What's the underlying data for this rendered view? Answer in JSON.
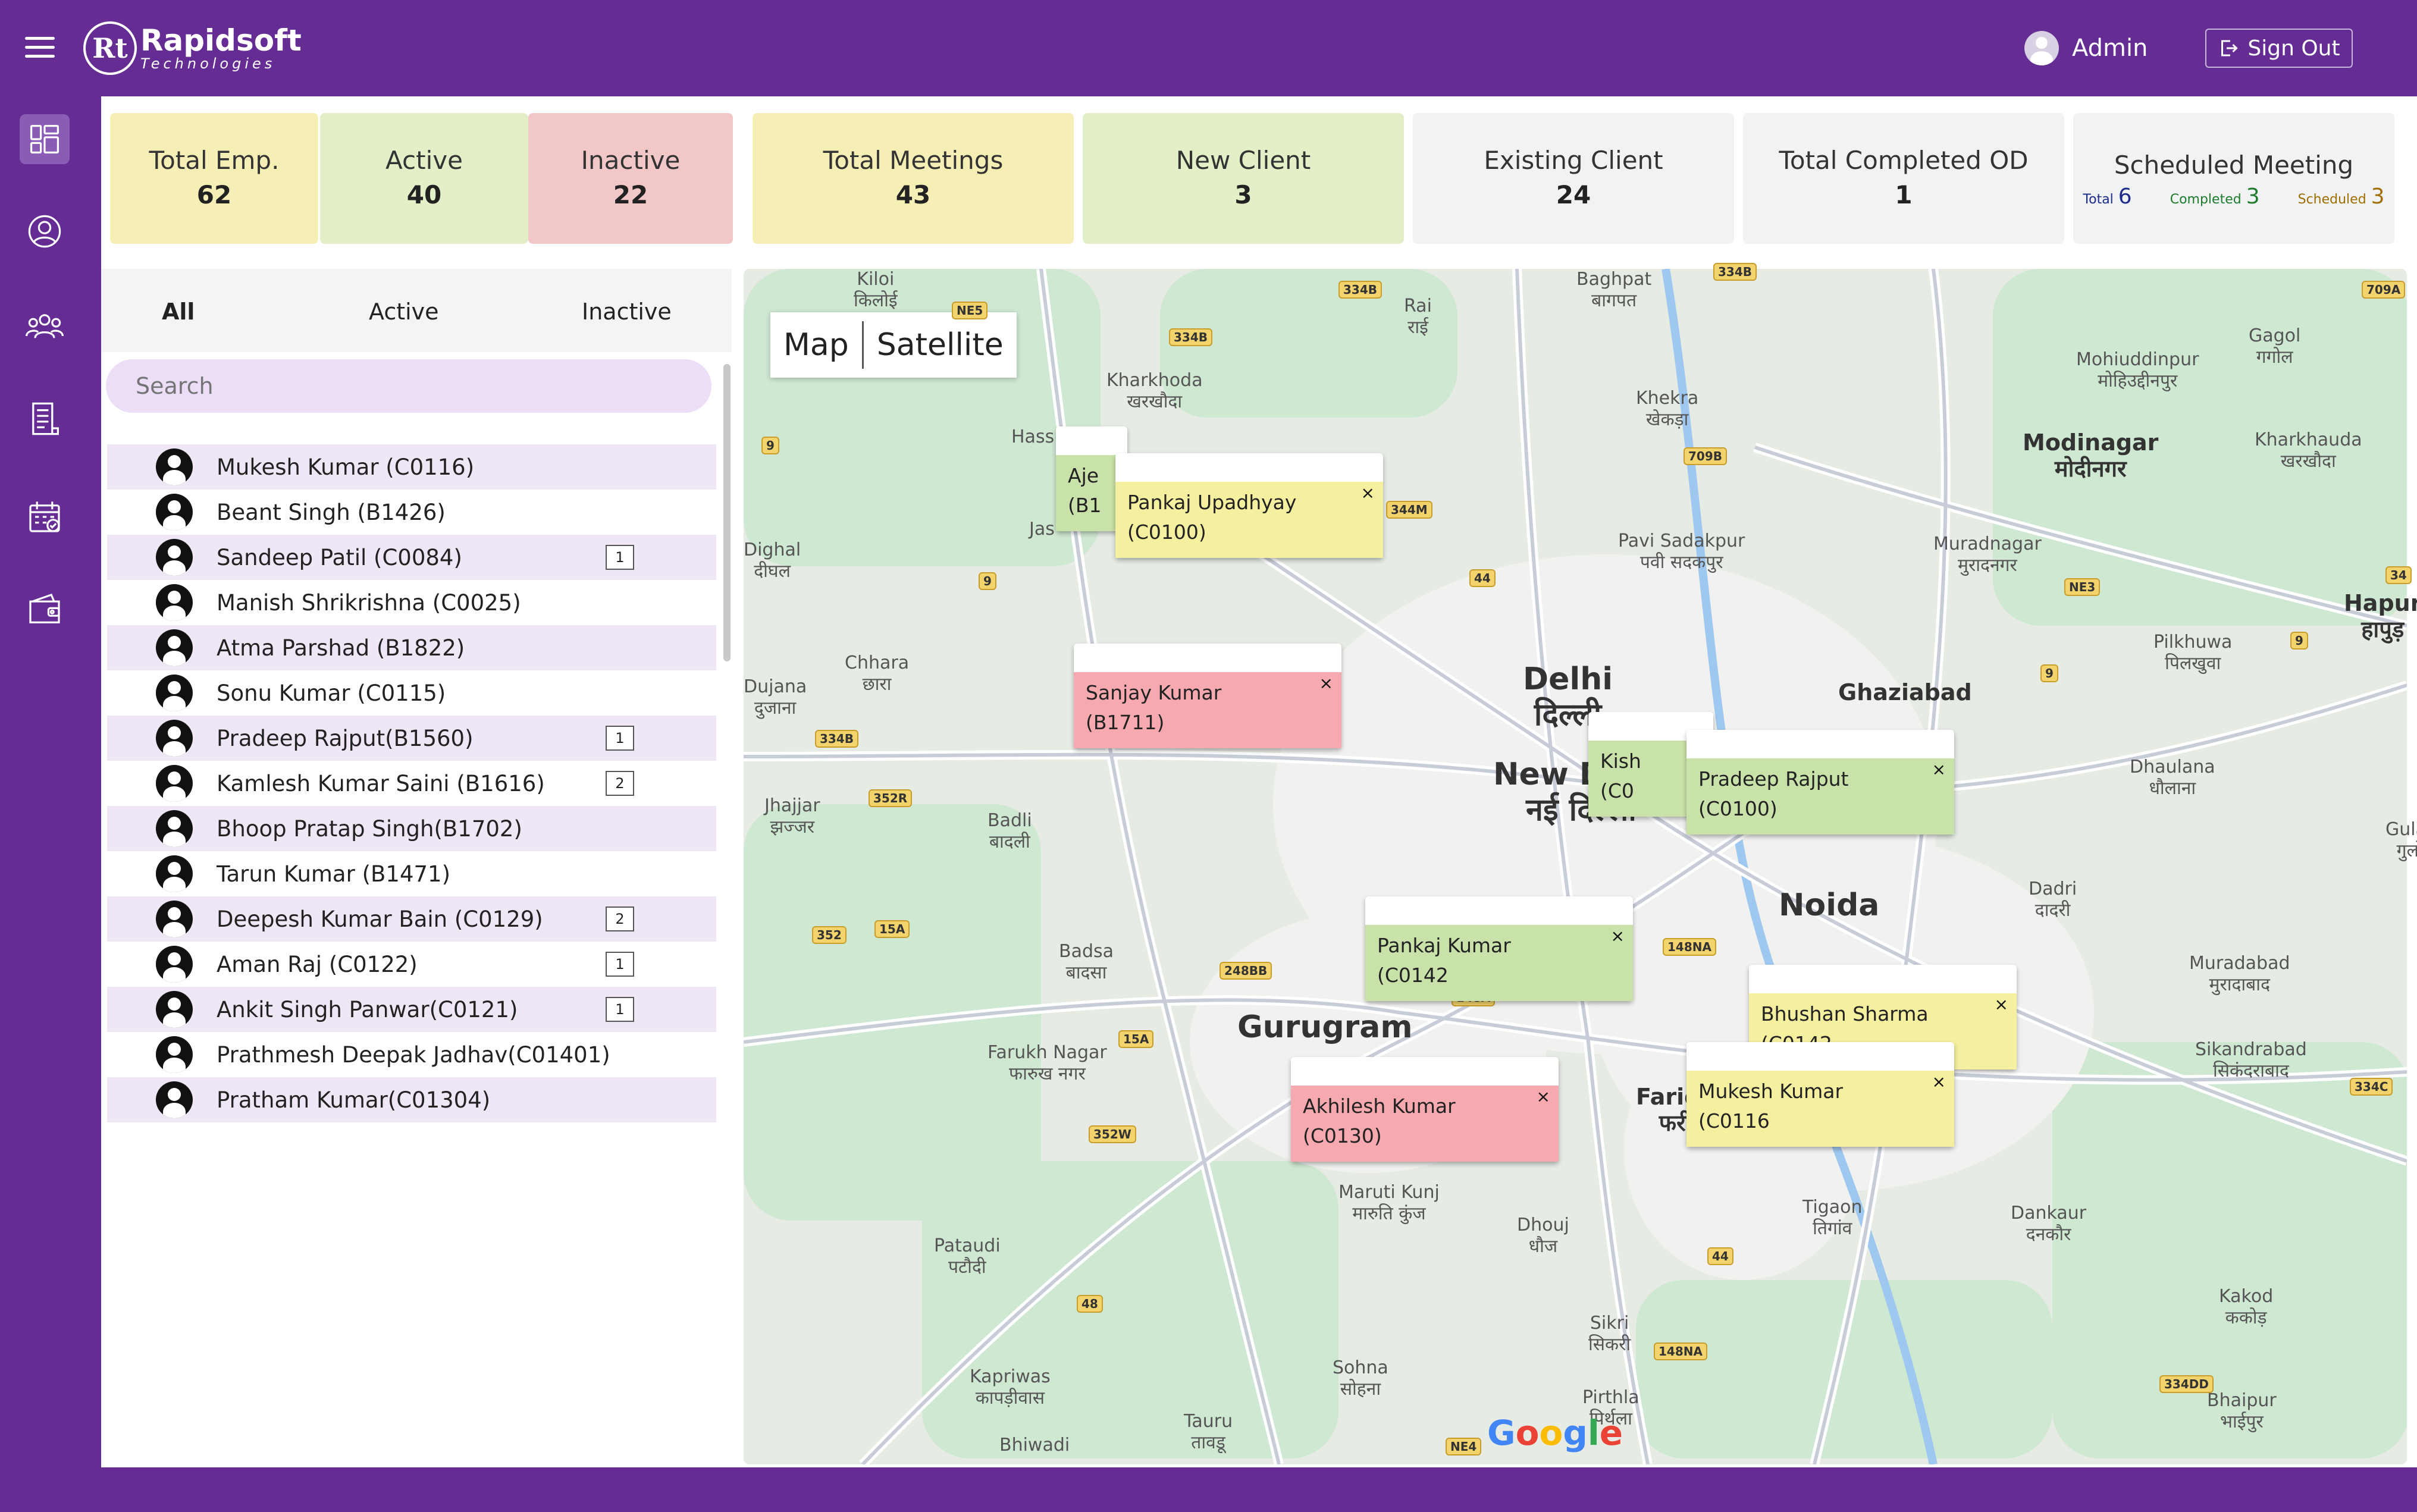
{
  "header": {
    "logo_mark": "Rt",
    "logo_name": "Rapidsoft",
    "logo_sub": "Technologies",
    "user_name": "Admin",
    "sign_out_label": "Sign Out"
  },
  "sidebar": {
    "items": [
      {
        "icon": "dashboard-icon",
        "active": true
      },
      {
        "icon": "profile-icon",
        "active": false
      },
      {
        "icon": "team-icon",
        "active": false
      },
      {
        "icon": "report-icon",
        "active": false
      },
      {
        "icon": "calendar-icon",
        "active": false
      },
      {
        "icon": "wallet-icon",
        "active": false
      }
    ]
  },
  "stats": {
    "total_emp": {
      "label": "Total Emp.",
      "value": "62"
    },
    "active": {
      "label": "Active",
      "value": "40"
    },
    "inactive": {
      "label": "Inactive",
      "value": "22"
    },
    "total_meetings": {
      "label": "Total Meetings",
      "value": "43"
    },
    "new_client": {
      "label": "New Client",
      "value": "3"
    },
    "existing_client": {
      "label": "Existing Client",
      "value": "24"
    },
    "total_completed_od": {
      "label": "Total Completed OD",
      "value": "1"
    },
    "scheduled_meeting": {
      "label": "Scheduled Meeting",
      "total_label": "Total",
      "total_value": "6",
      "completed_label": "Completed",
      "completed_value": "3",
      "scheduled_label": "Scheduled",
      "scheduled_value": "3"
    }
  },
  "filters": {
    "all": "All",
    "active": "Active",
    "inactive": "Inactive"
  },
  "search": {
    "placeholder": "Search"
  },
  "employees": [
    {
      "name": "Mukesh Kumar (C0116)",
      "count": ""
    },
    {
      "name": "Beant Singh (B1426)",
      "count": ""
    },
    {
      "name": "Sandeep Patil (C0084)",
      "count": "1"
    },
    {
      "name": "Manish Shrikrishna (C0025)",
      "count": ""
    },
    {
      "name": "Atma Parshad (B1822)",
      "count": ""
    },
    {
      "name": "Sonu Kumar (C0115)",
      "count": ""
    },
    {
      "name": "Pradeep Rajput(B1560)",
      "count": "1"
    },
    {
      "name": "Kamlesh Kumar Saini (B1616)",
      "count": "2"
    },
    {
      "name": "Bhoop Pratap Singh(B1702)",
      "count": ""
    },
    {
      "name": "Tarun Kumar (B1471)",
      "count": ""
    },
    {
      "name": "Deepesh Kumar Bain (C0129)",
      "count": "2"
    },
    {
      "name": "Aman Raj (C0122)",
      "count": "1"
    },
    {
      "name": "Ankit Singh Panwar(C0121)",
      "count": "1"
    },
    {
      "name": "Prathmesh Deepak Jadhav(C01401)",
      "count": ""
    },
    {
      "name": "Pratham Kumar(C01304)",
      "count": ""
    }
  ],
  "map": {
    "type_map": "Map",
    "type_satellite": "Satellite",
    "google": "Google",
    "popups": [
      {
        "line1": "Aje",
        "line2": "(B1"
      },
      {
        "line1": "Pankaj Upadhyay",
        "line2": "(C0100)"
      },
      {
        "line1": "Sanjay Kumar",
        "line2": "(B1711)"
      },
      {
        "line1": "Kish",
        "line2": "(C0"
      },
      {
        "line1": "Pradeep Rajput",
        "line2": "(C0100)"
      },
      {
        "line1": "Pankaj Kumar",
        "line2": "(C0142"
      },
      {
        "line1": "Bhushan Sharma",
        "line2": "(C0142"
      },
      {
        "line1": "Mukesh Kumar",
        "line2": "(C0116"
      },
      {
        "line1": "Akhilesh Kumar",
        "line2": "(C0130)"
      }
    ],
    "close_glyph": "×",
    "places": {
      "delhi": "Delhi",
      "delhi_hi": "दिल्ली",
      "new_delhi": "New Delhi",
      "new_delhi_hi": "नई दिल्ली",
      "noida": "Noida",
      "gurugram": "Gurugram",
      "faridabad": "Faridabad",
      "faridabad_hi": "फरीदाबाद",
      "ghaziabad": "Ghaziabad",
      "modinagar": "Modinagar",
      "modinagar_hi": "मोदीनगर",
      "hapur": "Hapur",
      "hapur_hi": "हापुड़",
      "kharkhoda": "Kharkhoda",
      "kharkhoda_hi": "खरखौदा",
      "khekra": "Khekra",
      "khekra_hi": "खेकड़ा",
      "baghpat": "Baghpat",
      "baghpat_hi": "बागपत",
      "rai": "Rai",
      "rai_hi": "राई",
      "mohiuddinpur": "Mohiuddinpur",
      "mohiuddinpur_hi": "मोहिउद्दीनपुर",
      "gagol": "Gagol",
      "gagol_hi": "गगोल",
      "kharkhauda": "Kharkhauda",
      "kharkhauda_hi": "खरखौदा",
      "pavi": "Pavi Sadakpur",
      "pavi_hi": "पवी सदकपुर",
      "muradnagar": "Muradnagar",
      "muradnagar_hi": "मुरादनगर",
      "pilkhuwa": "Pilkhuwa",
      "pilkhuwa_hi": "पिलखुवा",
      "dhaulana": "Dhaulana",
      "dhaulana_hi": "धौलाना",
      "gulaoti": "Gulaoti",
      "gulaoti_hi": "गुलोठी",
      "dadri": "Dadri",
      "dadri_hi": "दादरी",
      "muradabad": "Muradabad",
      "muradabad_hi": "मुरादाबाद",
      "sikandrabad": "Sikandrabad",
      "sikandrabad_hi": "सिकंदराबाद",
      "dankaur": "Dankaur",
      "dankaur_hi": "दनकौर",
      "tigaon": "Tigaon",
      "tigaon_hi": "तिगांव",
      "kakod": "Kakod",
      "kakod_hi": "ककोड़",
      "bhaipur": "Bhaipur",
      "bhaipur_hi": "भाईपुर",
      "chhara": "Chhara",
      "chhara_hi": "छारा",
      "badli": "Badli",
      "badli_hi": "बादली",
      "badsa": "Badsa",
      "badsa_hi": "बादसा",
      "farukh": "Farukh Nagar",
      "farukh_hi": "फारुख नगर",
      "jhajjar": "Jhajjar",
      "jhajjar_hi": "झज्जर",
      "dujana": "Dujana",
      "dujana_hi": "दुजाना",
      "dighal": "Dighal",
      "dighal_hi": "दीघल",
      "pataudi": "Pataudi",
      "pataudi_hi": "पटौदी",
      "maruti": "Maruti Kunj",
      "maruti_hi": "मारुति कुंज",
      "dhouj": "Dhouj",
      "dhouj_hi": "धौज",
      "sikri": "Sikri",
      "sikri_hi": "सिकरी",
      "pirthla": "Pirthla",
      "pirthla_hi": "पिर्थला",
      "sohna": "Sohna",
      "sohna_hi": "सोहना",
      "kapriwas": "Kapriwas",
      "kapriwas_hi": "कापड़ीवास",
      "tauru": "Tauru",
      "tauru_hi": "तावडू",
      "bhiwadi": "Bhiwadi",
      "kiloi": "Kiloi",
      "kiloi_hi": "किलोई",
      "hass": "Hass",
      "jas": "Jas"
    },
    "highways": [
      "NE5",
      "334B",
      "334B",
      "334B",
      "9",
      "709B",
      "44",
      "344M",
      "9",
      "NE3",
      "9",
      "9",
      "34",
      "709A",
      "334B",
      "352R",
      "352",
      "15A",
      "248BB",
      "148NA",
      "148A",
      "15A",
      "352W",
      "44",
      "48",
      "148NA",
      "334C",
      "334DD",
      "NE4"
    ]
  }
}
